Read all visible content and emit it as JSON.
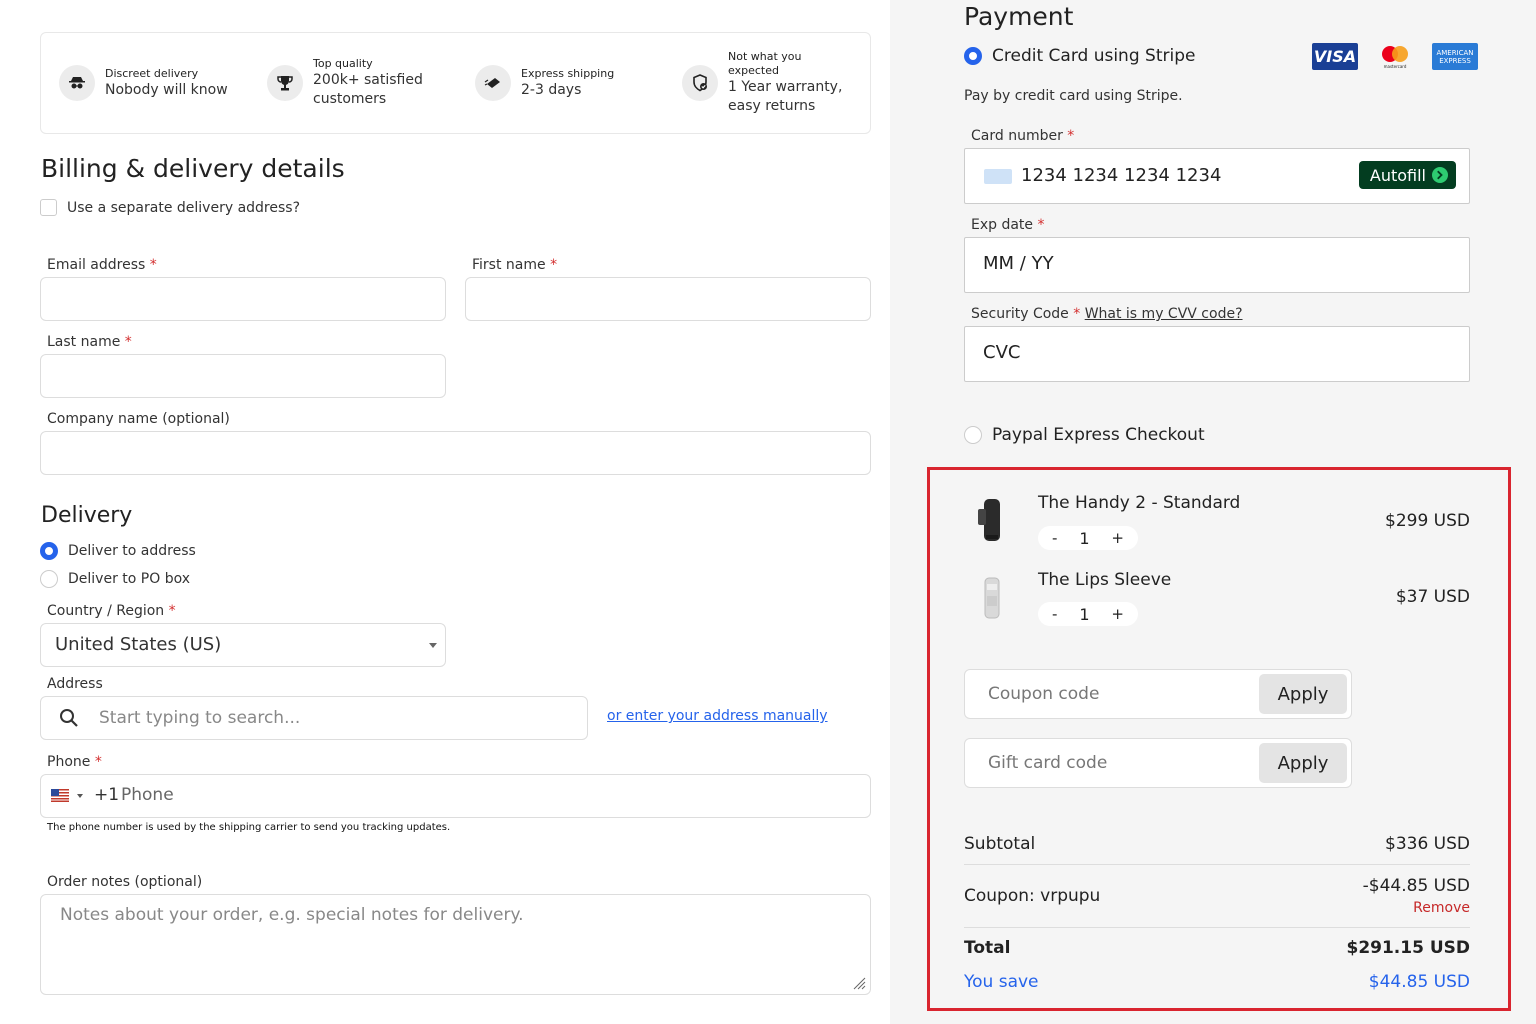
{
  "features": [
    {
      "small": "Discreet delivery",
      "big": "Nobody will know",
      "icon": "spy-icon"
    },
    {
      "small": "Top quality",
      "big": "200k+ satisfied customers",
      "icon": "trophy-icon"
    },
    {
      "small": "Express shipping",
      "big": "2-3 days",
      "icon": "shipping-icon"
    },
    {
      "small": "Not what you expected",
      "big": "1 Year warranty, easy returns",
      "icon": "shield-icon"
    }
  ],
  "billing": {
    "title": "Billing & delivery details",
    "separate_address": "Use a separate delivery address?",
    "required_mark": "*",
    "email_label": "Email address",
    "first_name_label": "First name",
    "last_name_label": "Last name",
    "company_label": "Company name (optional)"
  },
  "delivery": {
    "title": "Delivery",
    "option_address": "Deliver to address",
    "option_po": "Deliver to PO box",
    "country_label": "Country / Region",
    "country_value": "United States (US)",
    "address_label": "Address",
    "address_placeholder": "Start typing to search...",
    "manual_link": "or enter your address manually",
    "phone_label": "Phone",
    "phone_code": "+1",
    "phone_placeholder": "Phone",
    "phone_helper": "The phone number is used by the shipping carrier to send you tracking updates.",
    "notes_label": "Order notes (optional)",
    "notes_placeholder": "Notes about your order, e.g. special notes for delivery."
  },
  "payment": {
    "title": "Payment",
    "stripe_option": "Credit Card using Stripe",
    "stripe_desc": "Pay by credit card using Stripe.",
    "card_brands": [
      "VISA",
      "mastercard",
      "AMERICAN EXPRESS"
    ],
    "card_number_label": "Card number",
    "card_number_value": "1234 1234 1234 1234",
    "autofill": "Autofill",
    "exp_label": "Exp date",
    "exp_value": "MM / YY",
    "cvc_label": "Security Code",
    "cvv_link": "What is my CVV code?",
    "cvc_value": "CVC",
    "paypal_option": "Paypal Express Checkout"
  },
  "cart": {
    "items": [
      {
        "name": "The Handy 2 - Standard",
        "qty": "1",
        "price": "$299 USD"
      },
      {
        "name": "The Lips Sleeve",
        "qty": "1",
        "price": "$37 USD"
      }
    ],
    "minus": "-",
    "plus": "+",
    "coupon_placeholder": "Coupon code",
    "gift_placeholder": "Gift card code",
    "apply": "Apply"
  },
  "summary": {
    "subtotal_label": "Subtotal",
    "subtotal_value": "$336 USD",
    "coupon_label": "Coupon: vrpupu",
    "coupon_value": "-$44.85 USD",
    "remove": "Remove",
    "total_label": "Total",
    "total_value": "$291.15 USD",
    "save_label": "You save",
    "save_value": "$44.85 USD"
  },
  "colors": {
    "accent": "#2563eb",
    "required": "#d32f2f",
    "autofill_bg": "#033d20",
    "highlight": "#d9252f"
  }
}
